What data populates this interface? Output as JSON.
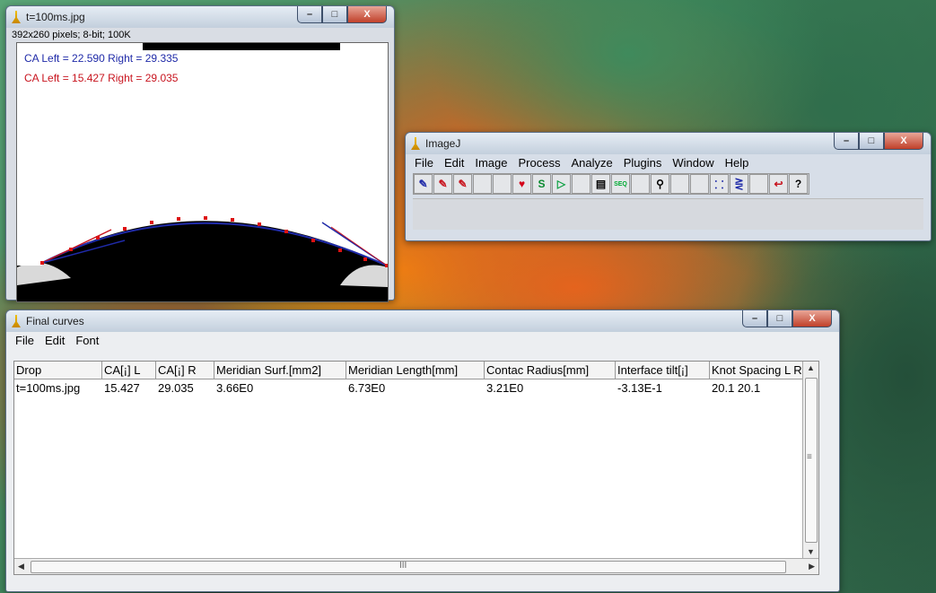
{
  "image_window": {
    "title": "t=100ms.jpg",
    "info": "392x260 pixels; 8-bit; 100K",
    "ca_lines": [
      {
        "text": "CA Left = 22.590 Right = 29.335",
        "color": "#1f2aa8"
      },
      {
        "text": "CA Left = 15.427 Right = 29.035",
        "color": "#c8141e"
      }
    ]
  },
  "imagej_window": {
    "title": "ImageJ",
    "menu": [
      "File",
      "Edit",
      "Image",
      "Process",
      "Analyze",
      "Plugins",
      "Window",
      "Help"
    ],
    "tools": [
      "pen-blue-icon",
      "pen-red-icon",
      "pen-red-dots-icon",
      "blank",
      "heart-icon",
      "curve-icon",
      "play-icon",
      "blank",
      "document-icon",
      "seq-icon",
      "blank",
      "magnifier-icon",
      "blank",
      "spline-icon",
      "curve-edit-icon",
      "blank",
      "undo-icon",
      "help-icon"
    ]
  },
  "results_window": {
    "title": "Final curves",
    "menu": [
      "File",
      "Edit",
      "Font"
    ],
    "columns": [
      "Drop",
      "CA[¡] L",
      "CA[¡] R",
      "Meridian Surf.[mm2]",
      "Meridian Length[mm]",
      "Contac Radius[mm]",
      "Interface tilt[¡]",
      "Knot Spacing L R"
    ],
    "rows": [
      [
        "t=100ms.jpg",
        "15.427",
        "29.035",
        "3.66E0",
        "6.73E0",
        "3.21E0",
        "-3.13E-1",
        "20.1 20.1"
      ]
    ],
    "scroll_marker": "III",
    "scroll_marker_v": "≡"
  },
  "window_controls": {
    "minimize": "–",
    "maximize": "□",
    "close": "X"
  }
}
